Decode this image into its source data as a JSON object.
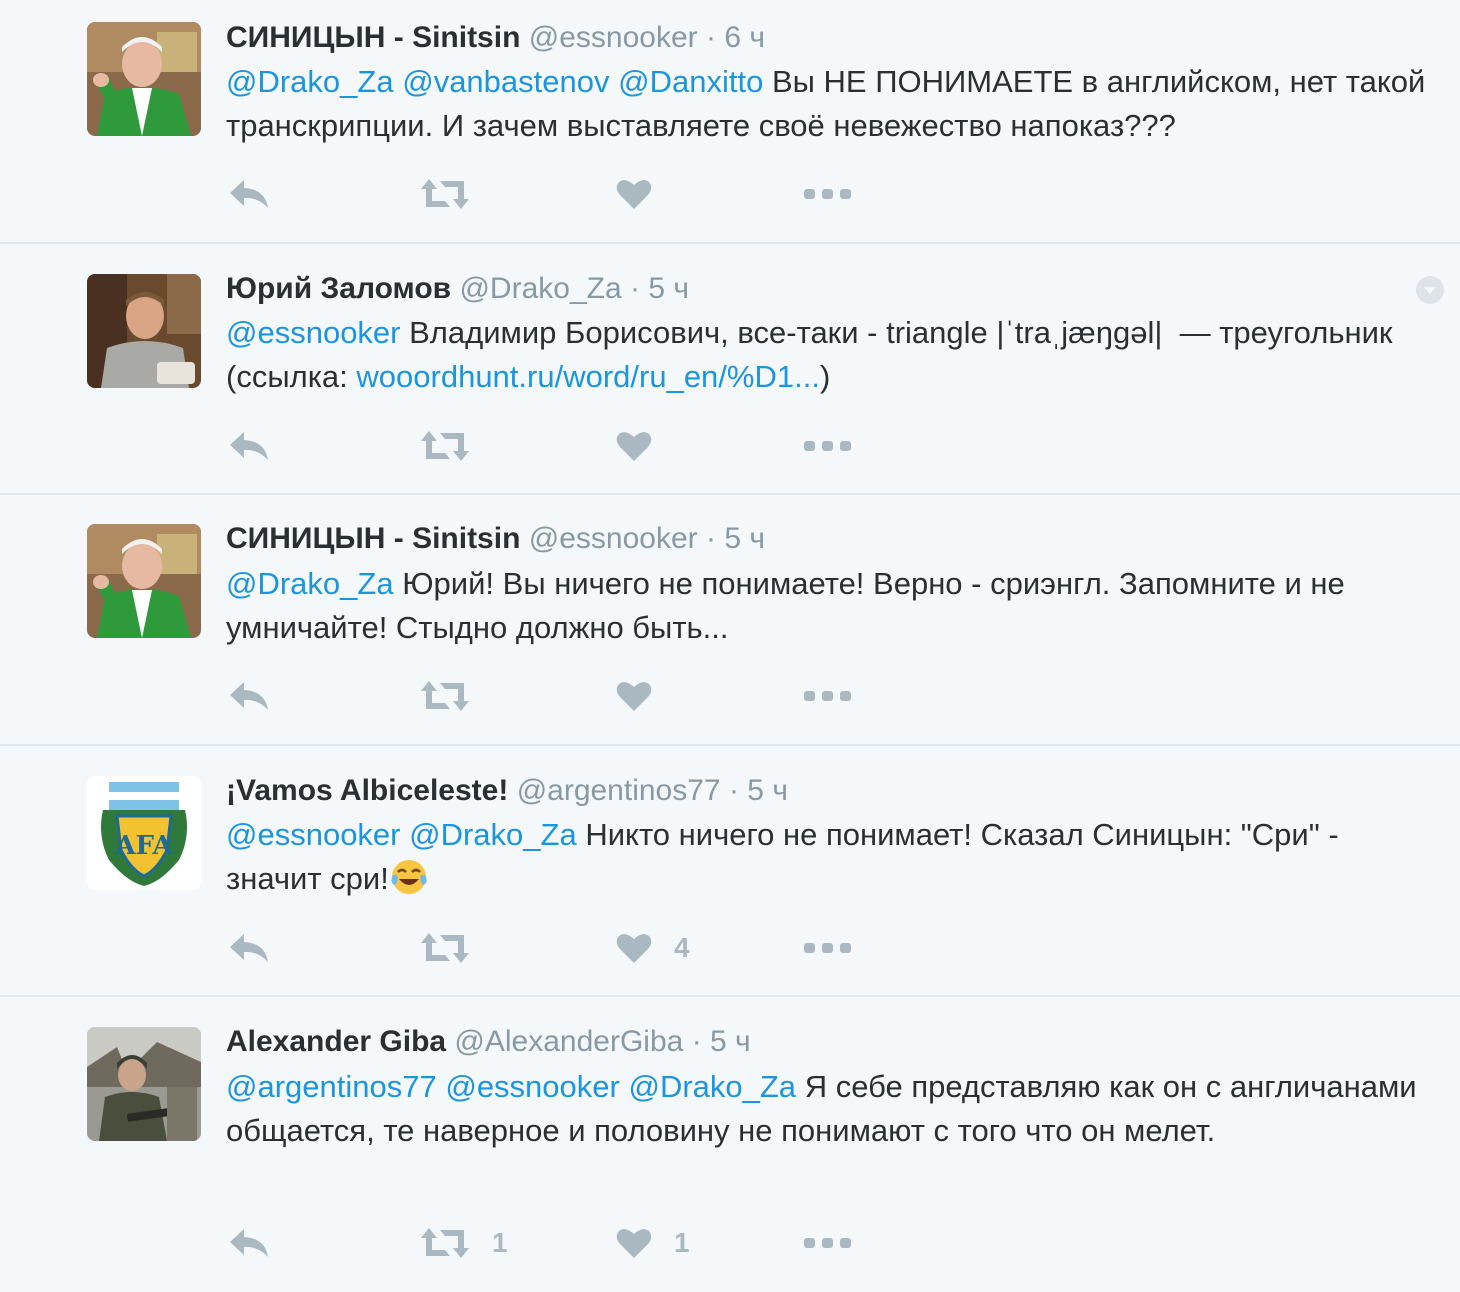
{
  "tweets": [
    {
      "fullname": "СИНИЦЫН - Sinitsin",
      "username": "@essnooker",
      "separator": "·",
      "time": "6 ч",
      "mentions": [
        "@Drako_Za",
        "@vanbastenov",
        "@Danxitto"
      ],
      "text": "Вы НЕ ПОНИМАЕТЕ в английском, нет такой транскрипции. И зачем выставляете своё невежество напоказ???",
      "avatar_icon": "avatar-green-jacket",
      "retweets": "",
      "likes": ""
    },
    {
      "fullname": "Юрий Заломов",
      "username": "@Drako_Za",
      "separator": "·",
      "time": "5 ч",
      "mentions": [
        "@essnooker"
      ],
      "text": "Владимир Борисович, все-таки - triangle |ˈtraˌjæŋgəl|  — треугольник (ссылка: ",
      "link": "wooordhunt.ru/word/ru_en/%D1...",
      "text_after_link": ")",
      "avatar_icon": "avatar-man-grey-shirt",
      "retweets": "",
      "likes": ""
    },
    {
      "fullname": "СИНИЦЫН - Sinitsin",
      "username": "@essnooker",
      "separator": "·",
      "time": "5 ч",
      "mentions": [
        "@Drako_Za"
      ],
      "text": "Юрий! Вы ничего не понимаете! Верно - сриэнгл. Запомните и не умничайте! Стыдно должно быть...",
      "avatar_icon": "avatar-green-jacket",
      "retweets": "",
      "likes": ""
    },
    {
      "fullname": "¡Vamos Albiceleste!",
      "username": "@argentinos77",
      "separator": "·",
      "time": "5 ч",
      "mentions": [
        "@essnooker",
        "@Drako_Za"
      ],
      "text": "Никто ничего не понимает! Сказал Синицын: \"Сри\" - значит сри!",
      "emoji": "face-with-tears-of-joy",
      "avatar_icon": "avatar-afa-crest",
      "retweets": "",
      "likes": "4"
    },
    {
      "fullname": "Alexander Giba",
      "username": "@AlexanderGiba",
      "separator": "·",
      "time": "5 ч",
      "mentions": [
        "@argentinos77",
        "@essnooker",
        "@Drako_Za"
      ],
      "text": "Я себе представляю как он с англичанами общается, те наверное и половину не понимают с того что он мелет.",
      "avatar_icon": "avatar-soldier",
      "retweets": "1",
      "likes": "1"
    }
  ],
  "icons": {
    "reply": "reply-icon",
    "retweet": "retweet-icon",
    "like": "heart-icon",
    "more": "more-dots-icon",
    "caret": "dropdown-caret-icon"
  },
  "colors": {
    "background": "#f5f8fa",
    "name": "#292f33",
    "meta": "#8899a6",
    "link": "#1b95e0",
    "action": "#aab8c2",
    "divider": "#e1e8ed"
  }
}
